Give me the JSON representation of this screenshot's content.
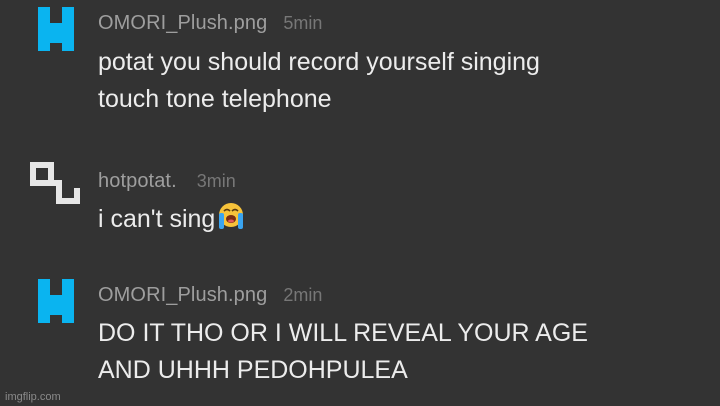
{
  "colors": {
    "background": "#333333",
    "username": "#9e9e9e",
    "timestamp": "#777777",
    "message_text": "#ececec",
    "avatar_omori": "#0ab4f0",
    "avatar_hotpotat": "#e6e6e6"
  },
  "messages": [
    {
      "username": "OMORI_Plush.png",
      "time": "5min",
      "avatar_icon": "pixel-avatar-icon",
      "lines": [
        "potat you should record yourself singing",
        "touch tone telephone"
      ]
    },
    {
      "username": "hotpotat.",
      "time": "3min",
      "avatar_icon": "pixel-avatar-icon",
      "text": "i can't sing",
      "emoji": "loudly-crying-face-emoji"
    },
    {
      "username": "OMORI_Plush.png",
      "time": "2min",
      "avatar_icon": "pixel-avatar-icon",
      "lines": [
        "DO IT THO OR I WILL REVEAL YOUR AGE",
        "AND UHHH PEDOHPULEA"
      ]
    }
  ],
  "watermark": "imgflip.com"
}
